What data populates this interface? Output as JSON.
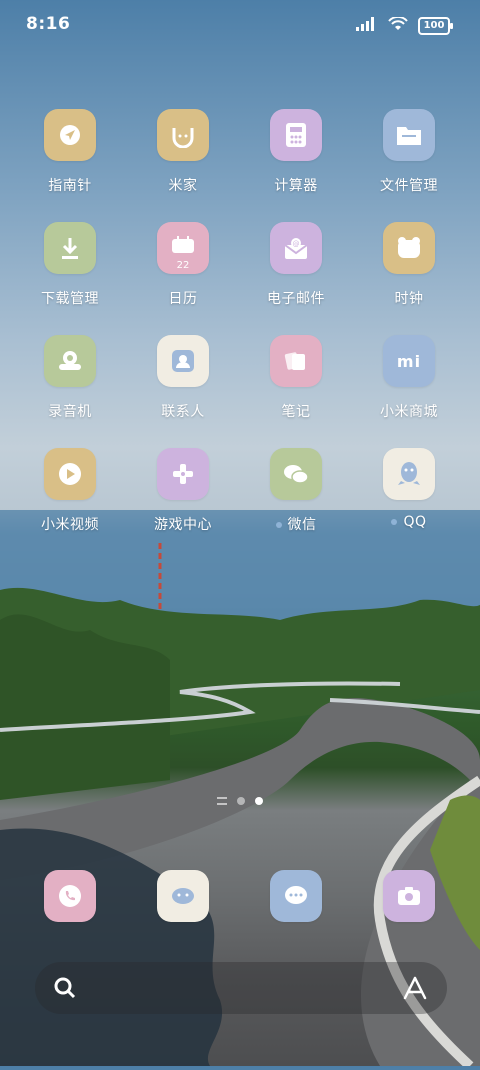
{
  "status": {
    "time": "8:16",
    "battery": "100"
  },
  "apps": [
    {
      "label": "指南针",
      "bg": "#d9bf87"
    },
    {
      "label": "米家",
      "bg": "#d9bf87"
    },
    {
      "label": "计算器",
      "bg": "#cdb3de"
    },
    {
      "label": "文件管理",
      "bg": "#9fb8d9"
    },
    {
      "label": "下载管理",
      "bg": "#b7c99a"
    },
    {
      "label": "日历",
      "bg": "#e3b0c4",
      "badge": "22"
    },
    {
      "label": "电子邮件",
      "bg": "#cdb3de"
    },
    {
      "label": "时钟",
      "bg": "#d9bf87"
    },
    {
      "label": "录音机",
      "bg": "#b7c99a"
    },
    {
      "label": "联系人",
      "bg": "#f1ede3"
    },
    {
      "label": "笔记",
      "bg": "#e3b0c4"
    },
    {
      "label": "小米商城",
      "bg": "#9fb8d9",
      "badge": "mi"
    },
    {
      "label": "小米视频",
      "bg": "#d9bf87"
    },
    {
      "label": "游戏中心",
      "bg": "#cdb3de"
    },
    {
      "label": "微信",
      "bg": "#b7c99a"
    },
    {
      "label": "QQ",
      "bg": "#f1ede3"
    }
  ],
  "dock": [
    {
      "name": "phone",
      "bg": "#e3b0c4"
    },
    {
      "name": "security",
      "bg": "#f1ede3"
    },
    {
      "name": "messages",
      "bg": "#9fb8d9"
    },
    {
      "name": "camera",
      "bg": "#cdb3de"
    }
  ]
}
